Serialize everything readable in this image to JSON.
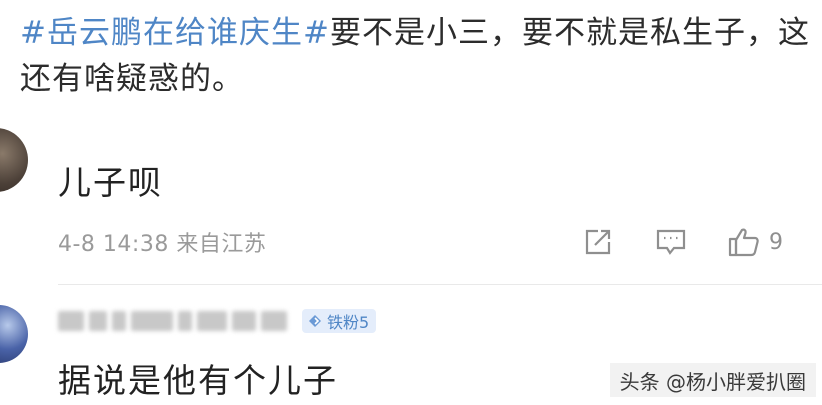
{
  "post": {
    "topic": "#岳云鹏在给谁庆生#",
    "text": "要不是小三，要不就是私生子，这还有啥疑惑的。"
  },
  "comments": [
    {
      "text": "儿子呗",
      "time": "4-8 14:38",
      "location": "来自江苏",
      "likes": "9"
    },
    {
      "badge": "铁粉5",
      "text": "据说是他有个儿子"
    }
  ],
  "icons": {
    "share": "share-icon",
    "comment": "comment-icon",
    "like": "thumbs-up-icon",
    "badge": "fan-badge-icon"
  },
  "colors": {
    "topic": "#4f86c6",
    "meta": "#9a9a9a",
    "badge_bg": "#e4edfb"
  },
  "watermark": "头条 @杨小胖爱扒圈"
}
